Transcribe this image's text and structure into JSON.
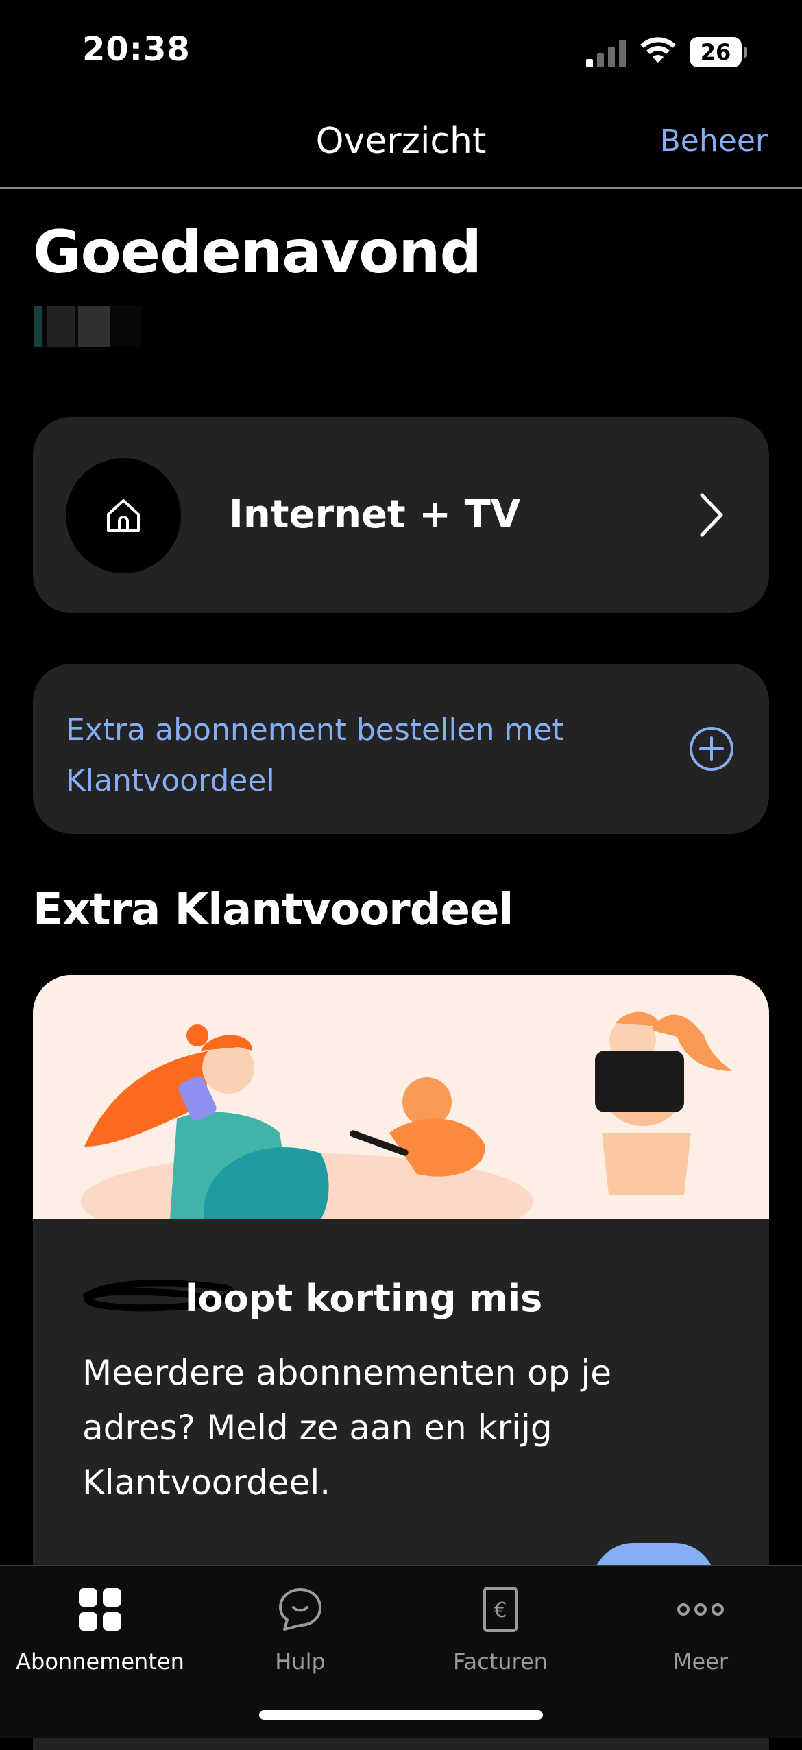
{
  "status_bar": {
    "time": "20:38",
    "battery_level": "26"
  },
  "nav": {
    "title": "Overzicht",
    "action_label": "Beheer"
  },
  "greeting": {
    "text": "Goedenavond"
  },
  "subscription_card": {
    "label": "Internet + TV",
    "icon": "home-icon"
  },
  "order_card": {
    "text": "Extra abonnement bestellen met Klantvoordeel",
    "icon": "plus-circle-icon"
  },
  "section": {
    "title": "Extra Klantvoordeel"
  },
  "promo": {
    "title": "loopt korting mis",
    "body": "Meerdere abonnementen op je adres? Meld ze aan en krijg Klantvoordeel."
  },
  "tabs": [
    {
      "label": "Abonnementen",
      "icon": "grid-icon",
      "active": true
    },
    {
      "label": "Hulp",
      "icon": "chat-icon",
      "active": false
    },
    {
      "label": "Facturen",
      "icon": "invoice-euro-icon",
      "active": false
    },
    {
      "label": "Meer",
      "icon": "more-dots-icon",
      "active": false
    }
  ],
  "colors": {
    "accent": "#86aef5",
    "card_bg": "#232323",
    "background": "#000000"
  }
}
